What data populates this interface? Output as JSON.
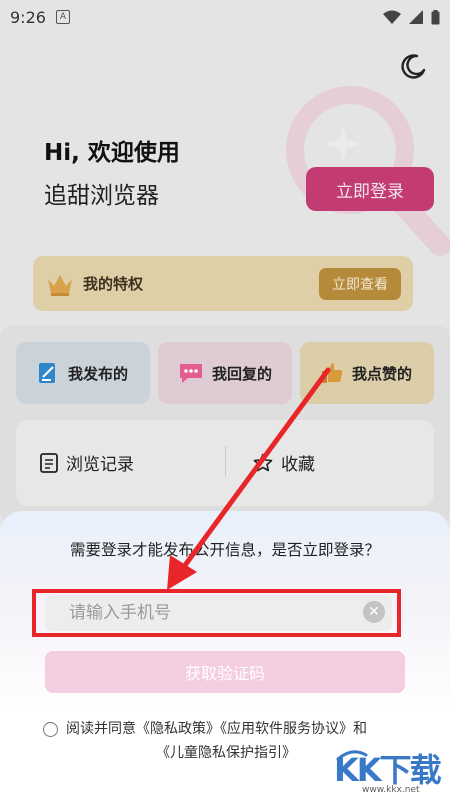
{
  "status": {
    "time": "9:26",
    "app_glyph": "A"
  },
  "header": {
    "greeting": "Hi, 欢迎使用",
    "app_name": "追甜浏览器",
    "login_label": "立即登录"
  },
  "privilege": {
    "title": "我的特权",
    "button": "立即查看"
  },
  "activity": [
    {
      "label": "我发布的",
      "icon": "edit-doc-icon"
    },
    {
      "label": "我回复的",
      "icon": "chat-bubble-icon"
    },
    {
      "label": "我点赞的",
      "icon": "thumbs-up-icon"
    }
  ],
  "history": [
    {
      "label": "浏览记录",
      "icon": "list-doc-icon"
    },
    {
      "label": "收藏",
      "icon": "star-icon"
    }
  ],
  "sheet": {
    "message": "需要登录才能发布公开信息，是否立即登录？",
    "phone_placeholder": "请输入手机号",
    "phone_value": "",
    "code_button": "获取验证码",
    "agree_line1": "阅读并同意《隐私政策》《应用软件服务协议》和",
    "agree_line2": "《儿童隐私保护指引》"
  },
  "watermark": {
    "text": "KK下载",
    "url": "www.kkx.net"
  },
  "colors": {
    "accent": "#c23c73",
    "gold": "#b58a3b",
    "highlight": "#e8262a",
    "code_button": "#f4cde0"
  }
}
